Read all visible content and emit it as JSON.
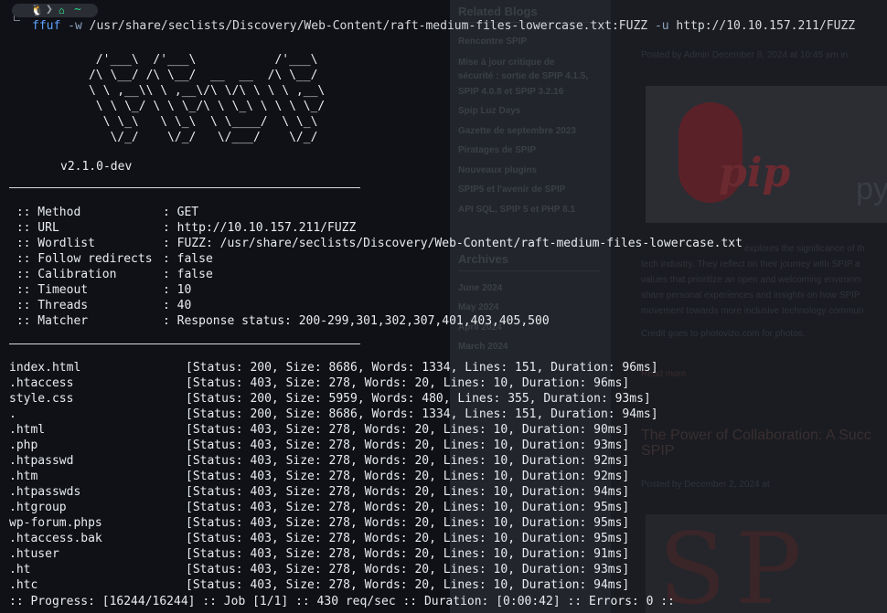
{
  "background_page": {
    "sidebar_heading": "Related Blogs",
    "sidebar_links": [
      "Rencontre SPIP",
      "Mise à jour critique de",
      "sécurité : sortie de SPIP 4.1.5,",
      "SPIP 4.0.8 et SPIP 3.2.16",
      "Spip Luz Days",
      "Gazette de septembre 2023",
      "Piratages de SPIP",
      "Nouveaux plugins",
      "SPIP5 et l'avenir de SPIP",
      "API SQL, SPIP 5 et PHP 8.1"
    ],
    "archives_heading": "Archives",
    "archive_links": [
      "June 2024",
      "May 2024",
      "April 2024",
      "March 2024"
    ],
    "post1_meta": "Posted by  Admin  December 8, 2024 at 10:45 am  in",
    "logo_letter": "S",
    "logo_word": "pip",
    "logo_side": "py",
    "post1_text": [
      "explores the significance of th",
      "tech industry. They reflect on their journey with SPIP a",
      "values that prioritize an open and welcoming environm",
      "share personal experiences and insights on how SPIP",
      "movement towards more inclusive technology commun"
    ],
    "post1_credit": "Credit goes to photovizo.com for photos.",
    "post1_readmore": "Read more",
    "post2_title_1": "The Power of Collaboration: A Succ",
    "post2_title_2": "SPIP",
    "post2_meta": "Posted by                       December 2, 2024 at",
    "post2_image_text": "SP"
  },
  "terminal": {
    "prompt": {
      "os_icon": "🐧",
      "home_icon": "⌂",
      "path": "~"
    },
    "command": {
      "program": "ffuf",
      "flag_w": "-w",
      "wordlist": "/usr/share/seclists/Discovery/Web-Content/raft-medium-files-lowercase.txt:FUZZ",
      "flag_u": "-u",
      "url": "http://10.10.157.211/FUZZ"
    },
    "banner": "       /'___\\  /'___\\           /'___\\       \n      /\\ \\__/ /\\ \\__/  __  __  /\\ \\__/       \n      \\ \\ ,__\\\\ \\ ,__\\/\\ \\/\\ \\ \\ \\ ,__\\      \n       \\ \\ \\_/ \\ \\ \\_/\\ \\ \\_\\ \\ \\ \\ \\_/      \n        \\ \\_\\   \\ \\_\\  \\ \\____/  \\ \\_\\       \n         \\/_/    \\/_/   \\/___/    \\/_/       ",
    "version": "v2.1.0-dev",
    "config": [
      {
        "key": " :: Method",
        "value": ": GET"
      },
      {
        "key": " :: URL",
        "value": ": http://10.10.157.211/FUZZ"
      },
      {
        "key": " :: Wordlist",
        "value": ": FUZZ: /usr/share/seclists/Discovery/Web-Content/raft-medium-files-lowercase.txt"
      },
      {
        "key": " :: Follow redirects",
        "value": ": false"
      },
      {
        "key": " :: Calibration",
        "value": ": false"
      },
      {
        "key": " :: Timeout",
        "value": ": 10"
      },
      {
        "key": " :: Threads",
        "value": ": 40"
      },
      {
        "key": " :: Matcher",
        "value": ": Response status: 200-299,301,302,307,401,403,405,500"
      }
    ],
    "results": [
      {
        "name": "index.html",
        "info": "[Status: 200, Size: 8686, Words: 1334, Lines: 151, Duration: 96ms]"
      },
      {
        "name": ".htaccess",
        "info": "[Status: 403, Size: 278, Words: 20, Lines: 10, Duration: 96ms]"
      },
      {
        "name": "style.css",
        "info": "[Status: 200, Size: 5959, Words: 480, Lines: 355, Duration: 93ms]"
      },
      {
        "name": ".",
        "info": "[Status: 200, Size: 8686, Words: 1334, Lines: 151, Duration: 94ms]"
      },
      {
        "name": ".html",
        "info": "[Status: 403, Size: 278, Words: 20, Lines: 10, Duration: 90ms]"
      },
      {
        "name": ".php",
        "info": "[Status: 403, Size: 278, Words: 20, Lines: 10, Duration: 93ms]"
      },
      {
        "name": ".htpasswd",
        "info": "[Status: 403, Size: 278, Words: 20, Lines: 10, Duration: 92ms]"
      },
      {
        "name": ".htm",
        "info": "[Status: 403, Size: 278, Words: 20, Lines: 10, Duration: 92ms]"
      },
      {
        "name": ".htpasswds",
        "info": "[Status: 403, Size: 278, Words: 20, Lines: 10, Duration: 94ms]"
      },
      {
        "name": ".htgroup",
        "info": "[Status: 403, Size: 278, Words: 20, Lines: 10, Duration: 95ms]"
      },
      {
        "name": "wp-forum.phps",
        "info": "[Status: 403, Size: 278, Words: 20, Lines: 10, Duration: 95ms]"
      },
      {
        "name": ".htaccess.bak",
        "info": "[Status: 403, Size: 278, Words: 20, Lines: 10, Duration: 95ms]"
      },
      {
        "name": ".htuser",
        "info": "[Status: 403, Size: 278, Words: 20, Lines: 10, Duration: 91ms]"
      },
      {
        "name": ".ht",
        "info": "[Status: 403, Size: 278, Words: 20, Lines: 10, Duration: 93ms]"
      },
      {
        "name": ".htc",
        "info": "[Status: 403, Size: 278, Words: 20, Lines: 10, Duration: 94ms]"
      }
    ],
    "progress": ":: Progress: [16244/16244] :: Job [1/1] :: 430 req/sec :: Duration: [0:00:42] :: Errors: 0 ::"
  },
  "colors": {
    "terminal_bg": "#0f1116",
    "text": "#e9ecef",
    "prompt_accent": "#2ecf87",
    "command_blue": "#5ea2ff"
  }
}
